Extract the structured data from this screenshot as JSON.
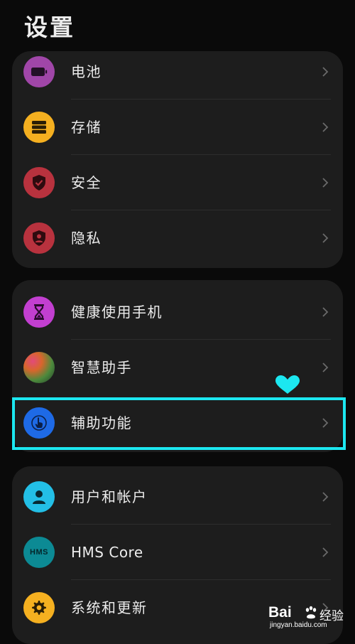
{
  "header": {
    "title": "设置"
  },
  "group1": {
    "items": [
      {
        "label": "电池",
        "icon": "battery-icon",
        "color": "#a046a8"
      },
      {
        "label": "存储",
        "icon": "storage-icon",
        "color": "#f5b020"
      },
      {
        "label": "安全",
        "icon": "shield-icon",
        "color": "#b8323e"
      },
      {
        "label": "隐私",
        "icon": "privacy-icon",
        "color": "#b8323e"
      }
    ]
  },
  "group2": {
    "items": [
      {
        "label": "健康使用手机",
        "icon": "hourglass-icon",
        "color": "#c23fd0"
      },
      {
        "label": "智慧助手",
        "icon": "assistant-orb-icon",
        "color": "#4c8a3c"
      },
      {
        "label": "辅助功能",
        "icon": "touch-hand-icon",
        "color": "#1e6ae6",
        "highlighted": true
      }
    ]
  },
  "group3": {
    "items": [
      {
        "label": "用户和帐户",
        "icon": "user-icon",
        "color": "#23bfe6"
      },
      {
        "label": "HMS Core",
        "icon": "hms-core-icon",
        "icon_text": "HMS",
        "color": "#0c8a94"
      },
      {
        "label": "系统和更新",
        "icon": "gear-icon",
        "color": "#f5b020"
      }
    ]
  },
  "annotation": {
    "highlight_color": "#1ce7f0",
    "heart_icon": "heart-icon"
  },
  "watermark": {
    "brand": "Bai",
    "brand_suffix": "经验",
    "site": "jingyan.baidu.com"
  }
}
